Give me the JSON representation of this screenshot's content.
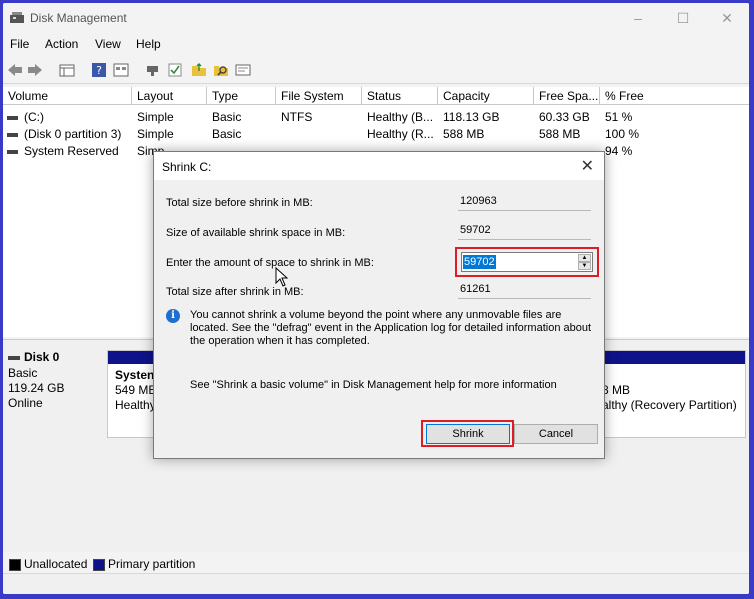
{
  "window": {
    "title": "Disk Management"
  },
  "menu": [
    "File",
    "Action",
    "View",
    "Help"
  ],
  "volume_list": {
    "columns": [
      "Volume",
      "Layout",
      "Type",
      "File System",
      "Status",
      "Capacity",
      "Free Spa...",
      "% Free"
    ],
    "rows": [
      [
        "(C:)",
        "Simple",
        "Basic",
        "NTFS",
        "Healthy (B...",
        "118.13 GB",
        "60.33 GB",
        "51 %"
      ],
      [
        "(Disk 0 partition 3)",
        "Simple",
        "Basic",
        "",
        "Healthy (R...",
        "588 MB",
        "588 MB",
        "100 %"
      ],
      [
        "System Reserved",
        "Simp",
        "",
        "",
        "",
        "",
        "",
        "94 %"
      ]
    ]
  },
  "disk_pane": {
    "disk_name": "Disk 0",
    "disk_type": "Basic",
    "disk_size": "119.24 GB",
    "disk_status": "Online",
    "partition_left": {
      "line1": "Systen",
      "line2": "549 MB",
      "line3": "Healthy"
    },
    "partition_right": {
      "line1": "8 MB",
      "line2": "althy (Recovery Partition)"
    }
  },
  "legend": {
    "unallocated": "Unallocated",
    "primary": "Primary partition",
    "colors": {
      "unallocated": "#000000",
      "primary": "#0e138a"
    }
  },
  "dialog": {
    "title": "Shrink C:",
    "fields": {
      "total_before_label": "Total size before shrink in MB:",
      "total_before_value": "120963",
      "available_label": "Size of available shrink space in MB:",
      "available_value": "59702",
      "amount_label": "Enter the amount of space to shrink in MB:",
      "amount_value": "59702",
      "total_after_label": "Total size after shrink in MB:",
      "total_after_value": "61261"
    },
    "info_text": "You cannot shrink a volume beyond the point where any unmovable files are located. See the \"defrag\" event in the Application log for detailed information about the operation when it has completed.",
    "help_text": "See \"Shrink a basic volume\" in Disk Management help for more information",
    "shrink_label": "Shrink",
    "cancel_label": "Cancel"
  },
  "icons": [
    "app-icon",
    "back-arrow-icon",
    "forward-arrow-icon",
    "list-view-icon",
    "help-icon",
    "properties-icon",
    "connect-icon",
    "check-icon",
    "folder-icon",
    "search-icon",
    "settings-icon",
    "info-icon",
    "close-icon",
    "mouse-cursor-icon"
  ]
}
